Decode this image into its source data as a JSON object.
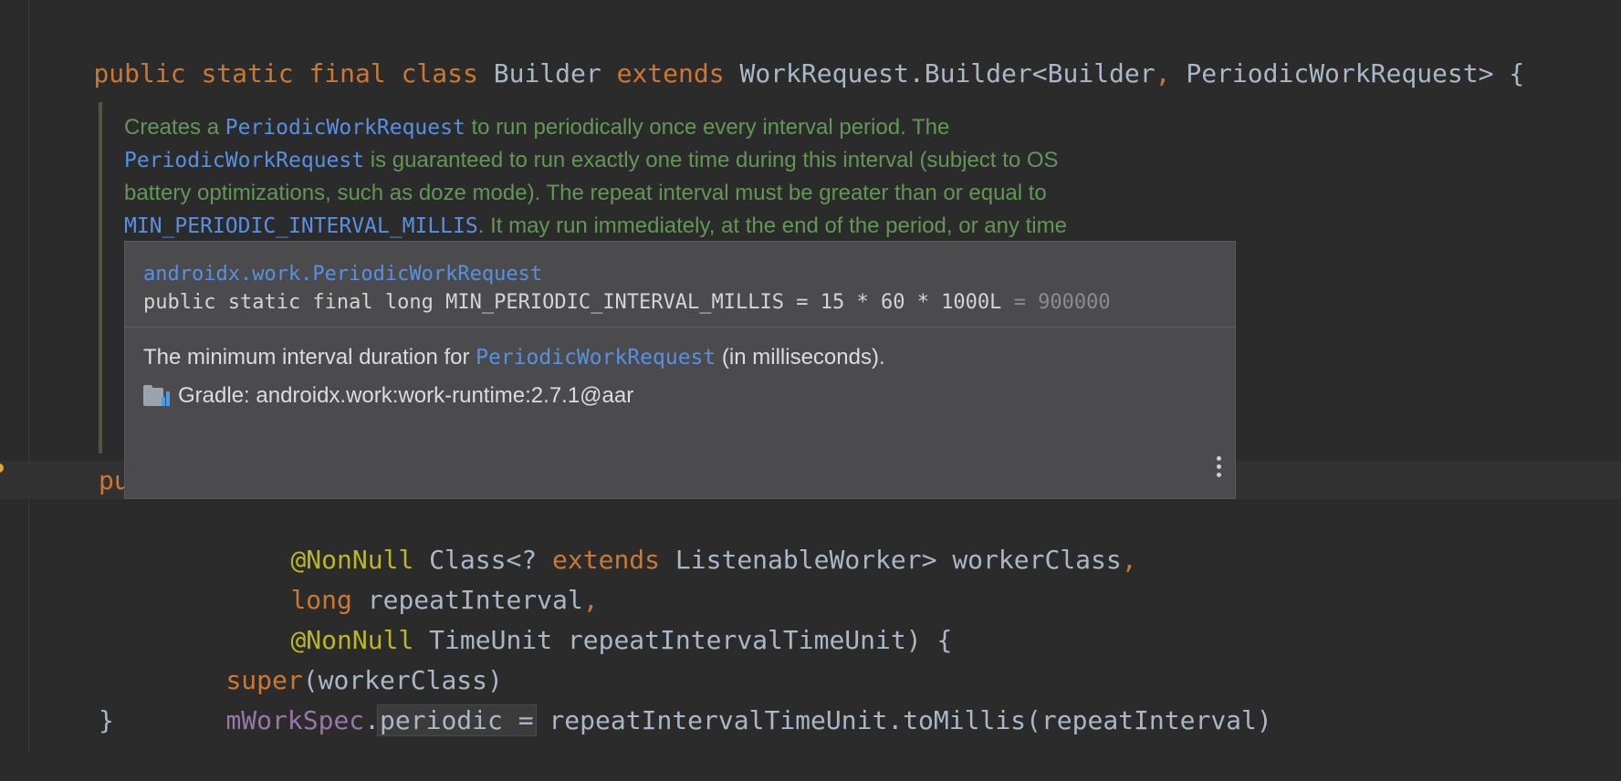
{
  "code": {
    "line1": {
      "kw1": "public static final class",
      "name": " Builder ",
      "kw2": "extends",
      "parent": " WorkRequest.Builder<Builder",
      "comma": ",",
      "parent2": " PeriodicWorkRequest> {"
    },
    "constructor_partial": "pu",
    "param1": {
      "ann": "@NonNull",
      "rest1": " Class<? ",
      "kw": "extends",
      "rest2": " ListenableWorker> workerClass",
      "comma": ","
    },
    "param2": {
      "kw": "long",
      "rest": " repeatInterval",
      "comma": ","
    },
    "param3": {
      "ann": "@NonNull",
      "rest": " TimeUnit repeatIntervalTimeUnit) {"
    },
    "super_line": {
      "kw": "super",
      "rest": "(workerClass)"
    },
    "assign_line": {
      "field": "mWorkSpec",
      "dot": ".",
      "prop": "periodic =",
      "rest": " repeatIntervalTimeUnit.toMillis(repeatInterval)"
    },
    "close_brace": "}"
  },
  "doc": {
    "l1a": "Creates a ",
    "l1link": "PeriodicWorkRequest",
    "l1b": " to run periodically once every interval period. The",
    "l2link": "PeriodicWorkRequest",
    "l2b": " is guaranteed to run exactly one time during this interval (subject to OS",
    "l3": "battery optimizations, such as doze mode). The repeat interval must be greater than or equal to",
    "l4link": "MIN_PERIODIC_INTERVAL_MILLIS",
    "l4b": ". It may run immediately, at the end of the period, or any time"
  },
  "tooltip": {
    "class_name": "androidx.work.PeriodicWorkRequest",
    "signature": "public static final long MIN_PERIODIC_INTERVAL_MILLIS = 15 * 60 * 1000L",
    "const_value": " = 900000",
    "desc_a": "The minimum interval duration for ",
    "desc_link": "PeriodicWorkRequest",
    "desc_b": " (in milliseconds).",
    "gradle": "Gradle: androidx.work:work-runtime:2.7.1@aar",
    "more_icon": "more-vertical-icon",
    "library_icon": "gradle-library-icon"
  },
  "colors": {
    "background": "#2b2b2b",
    "keyword": "#cc7832",
    "annotation": "#bbb529",
    "field": "#9876aa",
    "doc_comment": "#629755",
    "link": "#5890e2",
    "tooltip_bg": "#4b4b4d"
  }
}
